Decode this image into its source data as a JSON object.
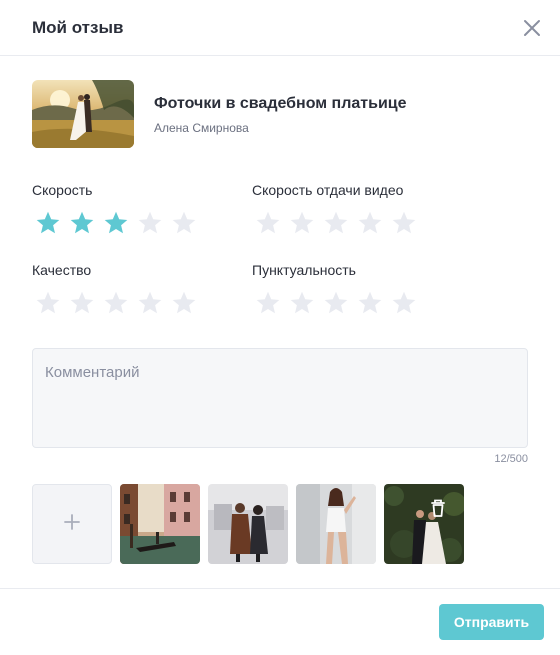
{
  "dialog": {
    "title": "Мой отзыв",
    "close_icon": "close-icon"
  },
  "project": {
    "title": "Фоточки в свадебном платьице",
    "author": "Алена Смирнова",
    "thumbnail": "wedding-couple-field-photo"
  },
  "ratings": [
    {
      "label": "Скорость",
      "value": 3,
      "max": 5
    },
    {
      "label": "Скорость отдачи видео",
      "value": 0,
      "max": 5
    },
    {
      "label": "Качество",
      "value": 0,
      "max": 5
    },
    {
      "label": "Пунктуальность",
      "value": 0,
      "max": 5
    }
  ],
  "comment": {
    "placeholder": "Комментарий",
    "value": "",
    "counter": "12/500"
  },
  "photos": {
    "add_icon": "plus-icon",
    "items": [
      {
        "name": "venice-canal-photo"
      },
      {
        "name": "couple-street-photo"
      },
      {
        "name": "woman-bodysuit-photo"
      },
      {
        "name": "wedding-couple-greenery-photo",
        "action_icon": "trash-icon"
      }
    ]
  },
  "footer": {
    "submit_label": "Отправить"
  },
  "colors": {
    "accent": "#5ec8d2",
    "star_active": "#5ec8d2",
    "star_inactive": "#e8eaf0",
    "text": "#2b2f3a",
    "muted": "#6b7080",
    "border": "#e9ebf0"
  }
}
